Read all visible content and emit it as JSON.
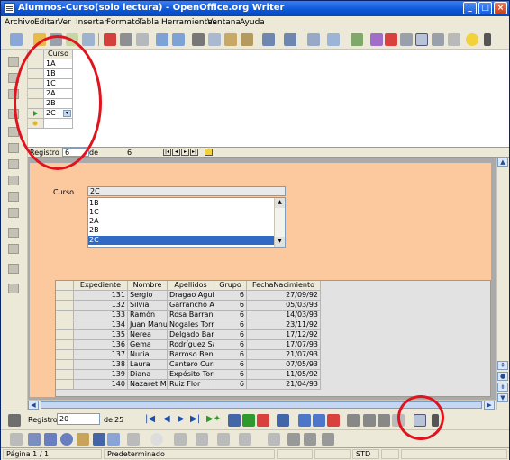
{
  "window": {
    "title": "Alumnos-Curso(solo lectura) - OpenOffice.org Writer",
    "minimize": "_",
    "maximize": "□",
    "close": "×"
  },
  "menu": [
    "Archivo",
    "Editar",
    "Ver",
    "Insertar",
    "Formato",
    "Tabla",
    "Herramientas",
    "Ventana",
    "Ayuda"
  ],
  "top_grid": {
    "header": "Curso",
    "rows": [
      "1A",
      "1B",
      "1C",
      "2A",
      "2B",
      "2C"
    ],
    "selected_index": 5,
    "nav": {
      "label": "Registro",
      "current": "6",
      "of": "de",
      "total": "6"
    }
  },
  "form": {
    "curso_label": "Curso",
    "curso_value": "2C",
    "list_items": [
      "1B",
      "1C",
      "2A",
      "2B",
      "2C"
    ],
    "list_selected": "2C"
  },
  "table": {
    "headers": [
      "Expediente",
      "Nombre",
      "Apellidos",
      "Grupo",
      "FechaNacimiento"
    ],
    "rows": [
      [
        "131",
        "Sergio",
        "Dragao Aguiler",
        "6",
        "27/09/92"
      ],
      [
        "132",
        "Silvia",
        "Garrancho Asp",
        "6",
        "05/03/93"
      ],
      [
        "133",
        "Ramón",
        "Rosa Barranca",
        "6",
        "14/03/93"
      ],
      [
        "134",
        "Juan Manuel",
        "Nogales Torrac",
        "6",
        "23/11/92"
      ],
      [
        "135",
        "Nerea",
        "Delgado Barbo",
        "6",
        "17/12/92"
      ],
      [
        "136",
        "Gema",
        "Rodríguez Sán",
        "6",
        "17/07/93"
      ],
      [
        "137",
        "Nuria",
        "Barroso Benite",
        "6",
        "21/07/93"
      ],
      [
        "138",
        "Laura",
        "Cantero Curac",
        "6",
        "07/05/93"
      ],
      [
        "139",
        "Diana",
        "Expósito Torre",
        "6",
        "11/05/92"
      ],
      [
        "140",
        "Nazaret Marí",
        "Ruiz Flor",
        "6",
        "21/04/93"
      ]
    ]
  },
  "bottom_nav": {
    "label": "Registro",
    "current": "20",
    "of": "de",
    "total": "25"
  },
  "status": {
    "page": "Página  1 / 1",
    "style": "Predeterminado",
    "mode": "STD"
  }
}
